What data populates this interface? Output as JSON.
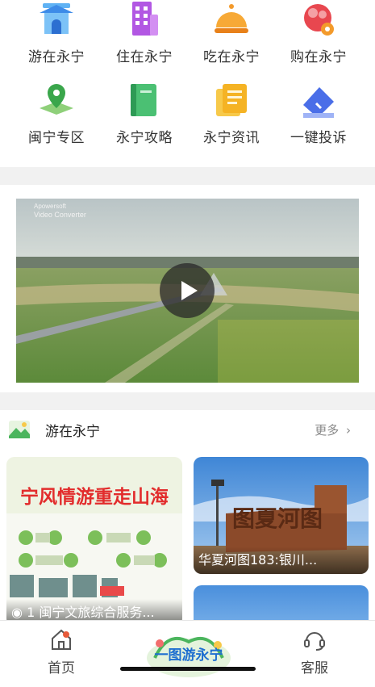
{
  "categories": [
    {
      "label": "游在永宁",
      "icon": "pavilion-icon"
    },
    {
      "label": "住在永宁",
      "icon": "hotel-building-icon"
    },
    {
      "label": "吃在永宁",
      "icon": "food-cloche-icon"
    },
    {
      "label": "购在永宁",
      "icon": "shopping-flower-icon"
    },
    {
      "label": "闽宁专区",
      "icon": "location-pin-map-icon"
    },
    {
      "label": "永宁攻略",
      "icon": "guide-book-icon"
    },
    {
      "label": "永宁资讯",
      "icon": "news-document-icon"
    },
    {
      "label": "一键投诉",
      "icon": "complaint-pen-icon"
    }
  ],
  "video": {
    "watermark_line1": "Apowersoft",
    "watermark_line2": "Video Converter",
    "play_icon": "play-icon"
  },
  "section": {
    "title": "游在永宁",
    "more": "更多",
    "cards": [
      {
        "caption": "1 闽宁文旅综合服务...",
        "poster_text": "宁风情游重走山海"
      },
      {
        "caption": "华夏河图183:银川...",
        "sign_text": "图夏河图"
      }
    ]
  },
  "tabbar": {
    "home": "首页",
    "center_logo": "一图游永宁",
    "service": "客服"
  },
  "colors": {
    "accent_blue": "#3d8be8",
    "accent_orange": "#f39a2b",
    "accent_purple": "#a44fd8",
    "accent_green": "#4bb55d"
  }
}
